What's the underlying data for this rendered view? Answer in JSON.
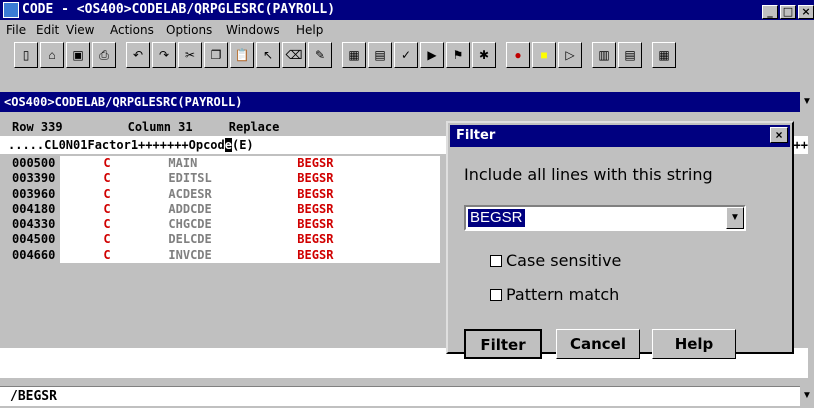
{
  "window": {
    "title": "CODE - <OS400>CODELAB/QRPGLESRC(PAYROLL)",
    "controls": [
      "_",
      "□",
      "×"
    ]
  },
  "menu": [
    "File",
    "Edit",
    "View",
    "Actions",
    "Options",
    "Windows",
    "Help"
  ],
  "toolbar": {
    "buttons": [
      "new-icon",
      "open-icon",
      "save-icon",
      "print-icon",
      "undo-icon",
      "redo-icon",
      "cut-icon",
      "copy-icon",
      "paste-icon",
      "pointer-icon",
      "eraser-icon",
      "highlight-icon",
      "split-icon",
      "compile-icon",
      "verify-icon",
      "run-icon",
      "debug-icon",
      "bug-icon",
      "stop-icon",
      "record-icon",
      "play-icon",
      "sections-icon",
      "calendar-icon",
      "grid-icon"
    ]
  },
  "path": "<OS400>CODELAB/QRPGLESRC(PAYROLL)",
  "status": {
    "row": "Row 339",
    "column": "Column 31",
    "mode": "Replace"
  },
  "ruler": {
    "before": ".....CL0N01Factor1+++++++Opcod",
    "cursor": "e",
    "after": "(E)"
  },
  "ruler_tail": "++",
  "lines": [
    {
      "seq": "000500",
      "type": "C",
      "factor": "MAIN",
      "opcode": "BEGSR"
    },
    {
      "seq": "003390",
      "type": "C",
      "factor": "EDITSL",
      "opcode": "BEGSR"
    },
    {
      "seq": "003960",
      "type": "C",
      "factor": "ACDESR",
      "opcode": "BEGSR"
    },
    {
      "seq": "004180",
      "type": "C",
      "factor": "ADDCDE",
      "opcode": "BEGSR"
    },
    {
      "seq": "004330",
      "type": "C",
      "factor": "CHGCDE",
      "opcode": "BEGSR"
    },
    {
      "seq": "004500",
      "type": "C",
      "factor": "DELCDE",
      "opcode": "BEGSR"
    },
    {
      "seq": "004660",
      "type": "C",
      "factor": "INVCDE",
      "opcode": "BEGSR"
    }
  ],
  "command_line": "/BEGSR",
  "dialog": {
    "title": "Filter",
    "close": "×",
    "label": "Include all lines with this string",
    "value": "BEGSR",
    "case_sensitive": "Case sensitive",
    "pattern_match": "Pattern match",
    "filter_button": "Filter",
    "cancel_button": "Cancel",
    "help_button": "Help"
  },
  "colors": {
    "titlebar": "#000080",
    "opcode": "#d00000",
    "factor": "#808080"
  }
}
